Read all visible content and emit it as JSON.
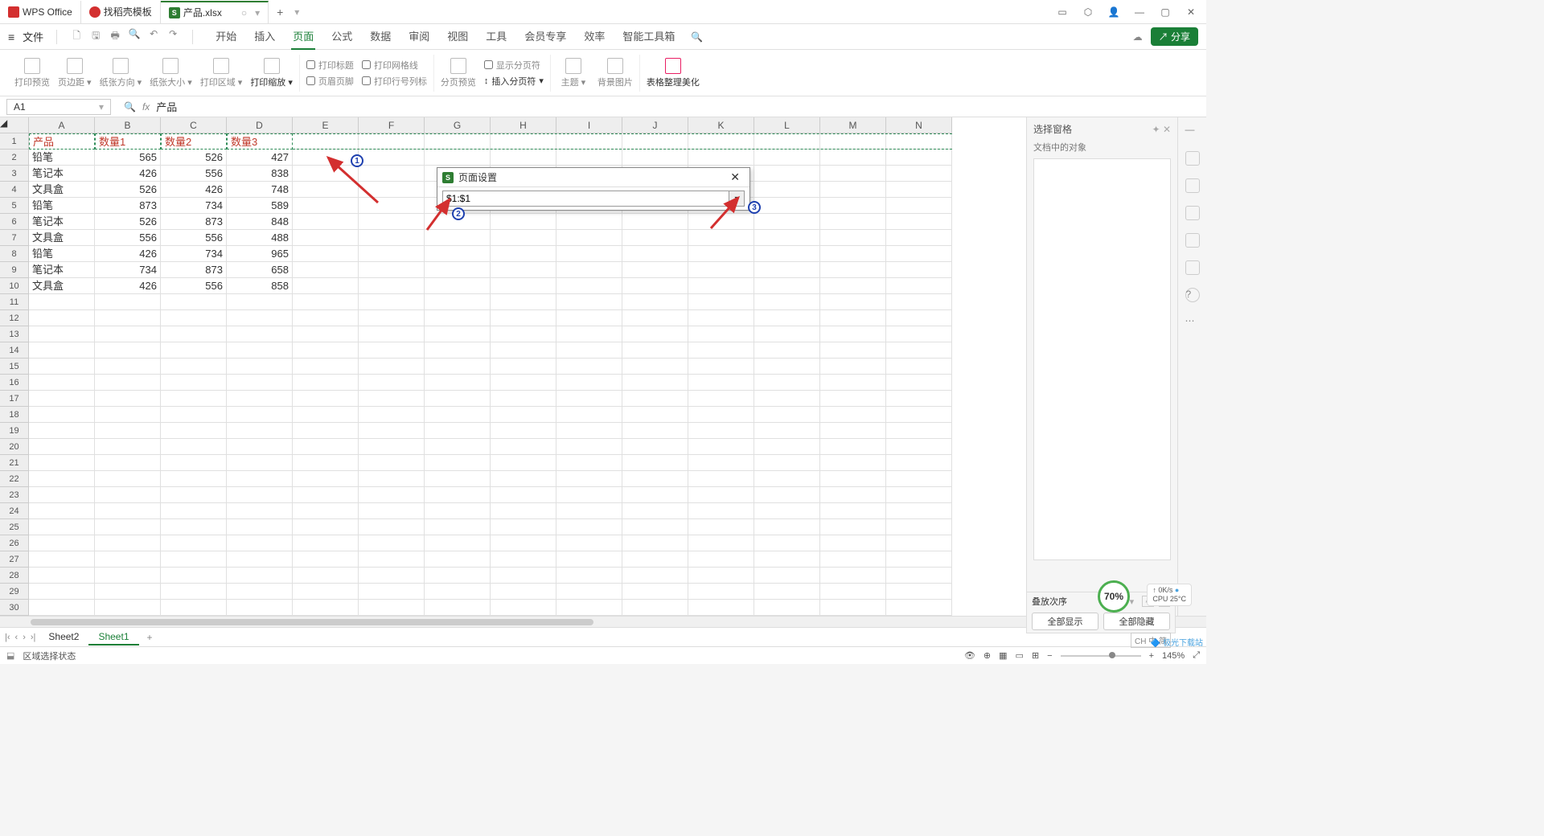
{
  "tabs": {
    "wps": "WPS Office",
    "template": "找稻壳模板",
    "file": "产品.xlsx"
  },
  "menu": {
    "file": "文件",
    "items": [
      "开始",
      "插入",
      "页面",
      "公式",
      "数据",
      "审阅",
      "视图",
      "工具",
      "会员专享",
      "效率",
      "智能工具箱"
    ],
    "active_index": 2,
    "share": "分享"
  },
  "ribbon": {
    "print_preview": "打印预览",
    "margins": "页边距",
    "orientation": "纸张方向",
    "size": "纸张大小",
    "print_area": "打印区域",
    "print_scale": "打印缩放",
    "print_title": "打印标题",
    "gridlines": "打印网格线",
    "header_footer": "页眉页脚",
    "row_col_label": "打印行号列标",
    "page_preview": "分页预览",
    "show_pagebreak": "显示分页符",
    "insert_break": "插入分页符",
    "theme": "主题",
    "bg_image": "背景图片",
    "beautify": "表格整理美化"
  },
  "name_box": "A1",
  "formula_value": "产品",
  "columns": [
    "A",
    "B",
    "C",
    "D",
    "E",
    "F",
    "G",
    "H",
    "I",
    "J",
    "K",
    "L",
    "M",
    "N"
  ],
  "header_row": [
    "产品",
    "数量1",
    "数量2",
    "数量3"
  ],
  "data": [
    [
      "铅笔",
      "565",
      "526",
      "427"
    ],
    [
      "笔记本",
      "426",
      "556",
      "838"
    ],
    [
      "文具盒",
      "526",
      "426",
      "748"
    ],
    [
      "铅笔",
      "873",
      "734",
      "589"
    ],
    [
      "笔记本",
      "526",
      "873",
      "848"
    ],
    [
      "文具盒",
      "556",
      "556",
      "488"
    ],
    [
      "铅笔",
      "426",
      "734",
      "965"
    ],
    [
      "笔记本",
      "734",
      "873",
      "658"
    ],
    [
      "文具盒",
      "426",
      "556",
      "858"
    ]
  ],
  "total_rows": 30,
  "dialog": {
    "title": "页面设置",
    "value": "$1:$1"
  },
  "side": {
    "title": "选择窗格",
    "sub": "文档中的对象"
  },
  "stack": {
    "title": "叠放次序",
    "show_all": "全部显示",
    "hide_all": "全部隐藏"
  },
  "sheets": {
    "names": [
      "Sheet2",
      "Sheet1"
    ],
    "active": 1
  },
  "status": {
    "mode": "区域选择状态",
    "zoom": "145%"
  },
  "perf": {
    "pct": "70%",
    "net": "0K/s",
    "cpu": "CPU 25°C"
  },
  "watermark": "极光下载站",
  "ime": "CH 中 简",
  "badges": [
    "1",
    "2",
    "3"
  ]
}
